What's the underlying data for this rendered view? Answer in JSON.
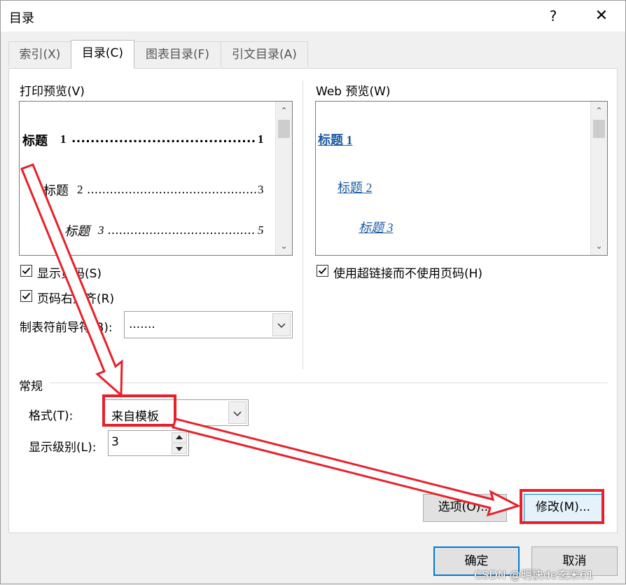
{
  "dialog": {
    "title": "目录",
    "help_label": "?",
    "close_label": "✕"
  },
  "tabs": [
    {
      "label": "索引(X)"
    },
    {
      "label": "目录(C)"
    },
    {
      "label": "图表目录(F)"
    },
    {
      "label": "引文目录(A)"
    }
  ],
  "print_preview": {
    "label": "打印预览(V)",
    "entries": [
      {
        "text": "标题",
        "num": "1",
        "page": "1"
      },
      {
        "text": "标题",
        "num": "2",
        "page": "3"
      },
      {
        "text": "标题",
        "num": "3",
        "page": "5"
      }
    ],
    "scroll_up": "⌃",
    "scroll_down": "⌄"
  },
  "web_preview": {
    "label": "Web 预览(W)",
    "entries": [
      {
        "text": "标题 1"
      },
      {
        "text": "标题 2"
      },
      {
        "text": "标题 3"
      }
    ]
  },
  "options": {
    "show_page_numbers": {
      "label": "显示页码(S)",
      "checked": true
    },
    "right_align": {
      "label": "页码右对齐(R)",
      "checked": true
    },
    "tab_leader": {
      "label": "制表符前导符(B):",
      "value": "......."
    },
    "use_hyperlinks": {
      "label": "使用超链接而不使用页码(H)",
      "checked": true
    }
  },
  "general": {
    "heading": "常规",
    "format": {
      "label": "格式(T):",
      "value": "来自模板"
    },
    "levels": {
      "label": "显示级别(L):",
      "value": "3"
    }
  },
  "buttons": {
    "options": "选项(O)...",
    "modify": "修改(M)...",
    "ok": "确定",
    "cancel": "取消"
  },
  "watermark": "CSDN @明快de玄米61",
  "colors": {
    "annotation": "#e8202a",
    "link": "#1a5ba6",
    "focus": "#0078d7"
  }
}
